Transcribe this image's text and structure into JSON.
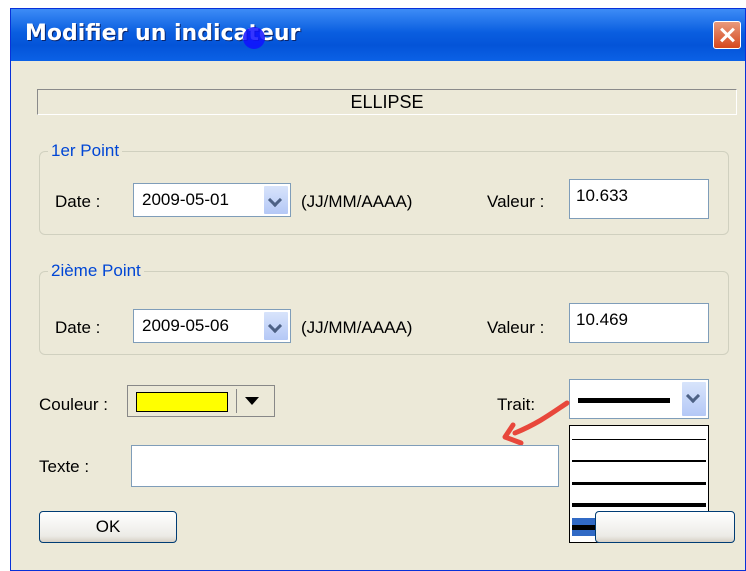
{
  "window": {
    "title": "Modifier un indicateur",
    "close_icon": "close-icon"
  },
  "shape_type": "ELLIPSE",
  "point1": {
    "legend": "1er Point",
    "date_label": "Date :",
    "date_value": "2009-05-01",
    "date_format": "(JJ/MM/AAAA)",
    "value_label": "Valeur :",
    "value": "10.633"
  },
  "point2": {
    "legend": "2ième Point",
    "date_label": "Date :",
    "date_value": "2009-05-06",
    "date_format": "(JJ/MM/AAAA)",
    "value_label": "Valeur :",
    "value": "10.469"
  },
  "color": {
    "label": "Couleur :",
    "selected": "#ffff00"
  },
  "trait": {
    "label": "Trait:",
    "options_count": 5,
    "selected_index": 4
  },
  "text": {
    "label": "Texte   :",
    "value": ""
  },
  "buttons": {
    "ok": "OK"
  },
  "colors": {
    "title_bar": "#0454d8",
    "legend_text": "#0046d5",
    "dialog_bg": "#ece9d8",
    "annotation_arrow": "#e8473b",
    "selection": "#316ac5"
  }
}
